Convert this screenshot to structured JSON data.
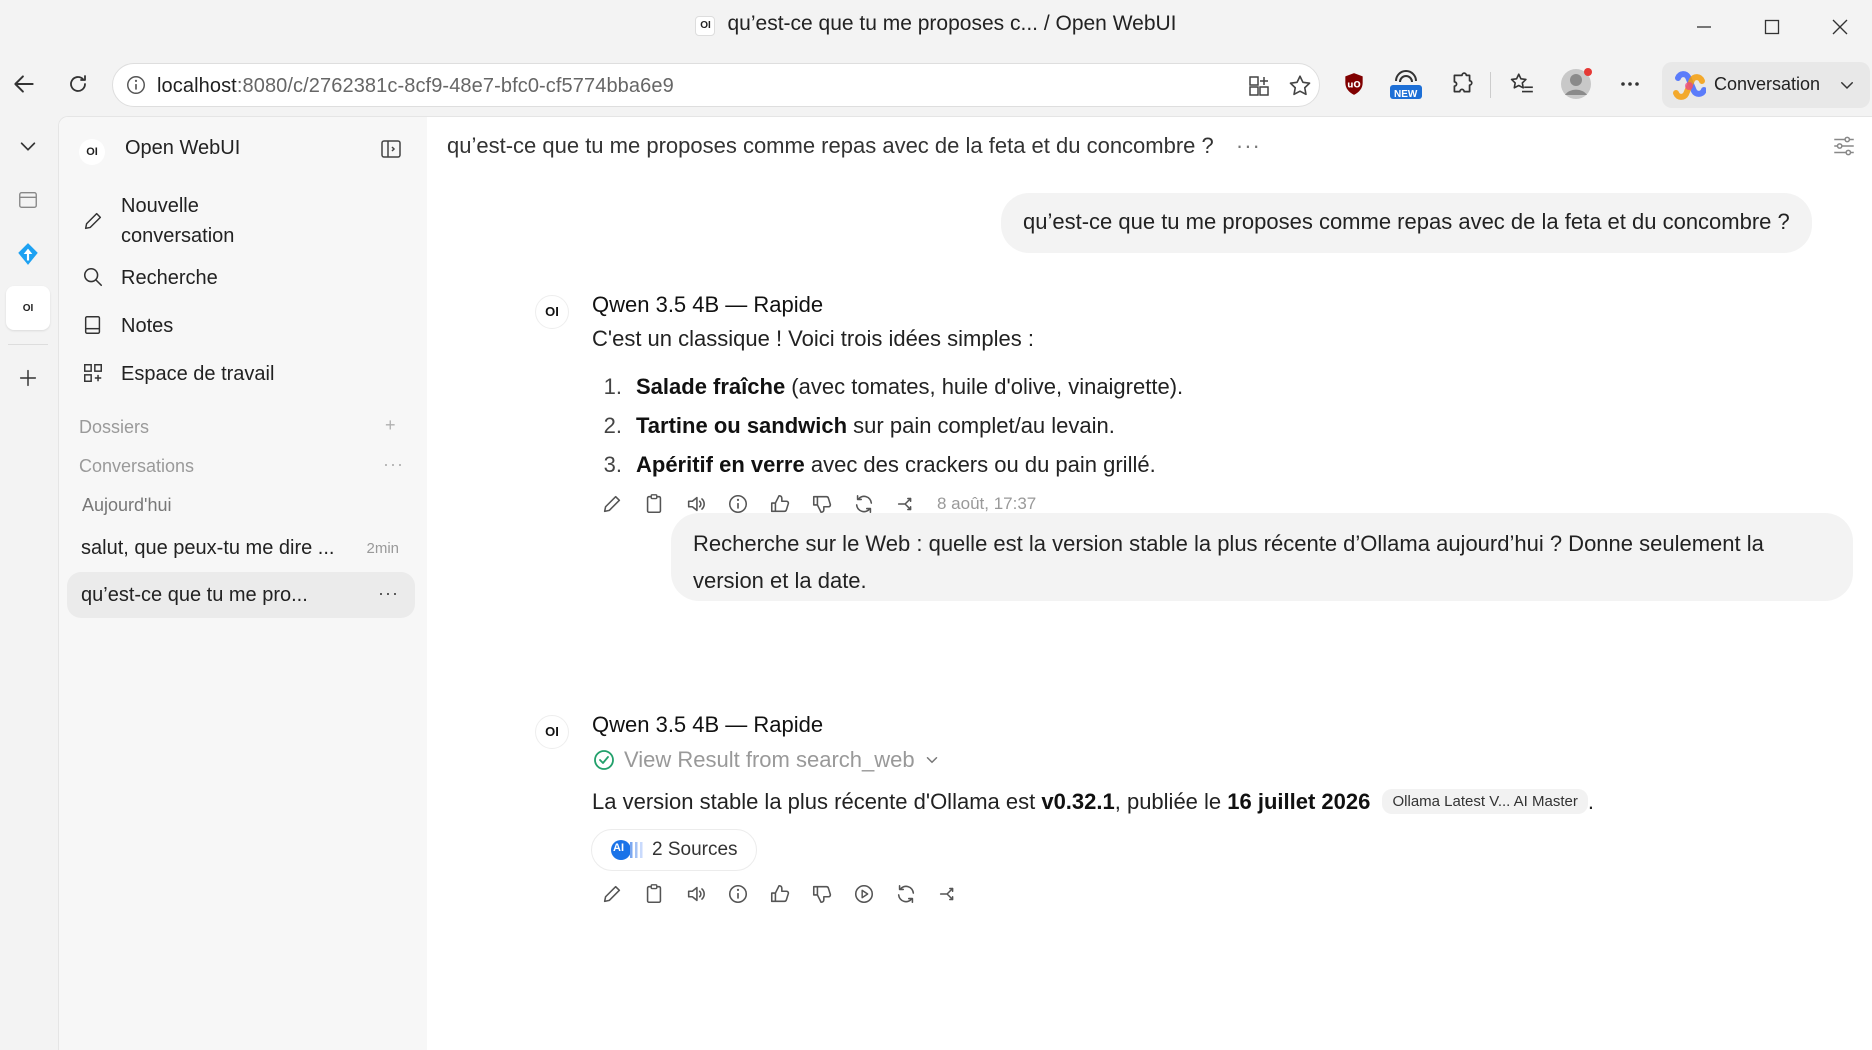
{
  "browser": {
    "window_title": "qu’est-ce que tu me proposes c... / Open WebUI",
    "favicon_text": "OI",
    "url_host": "localhost",
    "url_path": ":8080/c/2762381c-8cf9-48e7-bfc0-cf5774bba6e9",
    "extension_badge": "NEW",
    "copilot_label": "Conversation"
  },
  "tabstrip": {
    "active_tab_text": "OI"
  },
  "sidebar": {
    "logo_text": "OI",
    "brand": "Open WebUI",
    "nav": [
      {
        "label": "Nouvelle conversation",
        "line1": "Nouvelle",
        "line2": "conversation"
      },
      {
        "label": "Recherche"
      },
      {
        "label": "Notes"
      },
      {
        "label": "Espace de travail"
      }
    ],
    "folders_label": "Dossiers",
    "folders_add": "+",
    "conversations_label": "Conversations",
    "conversations_more": "···",
    "today_label": "Aujourd'hui",
    "conversations": [
      {
        "title": "salut, que peux-tu me dire ...",
        "meta": "2min"
      },
      {
        "title": "qu’est-ce que tu me pro...",
        "meta": "···"
      }
    ]
  },
  "chat": {
    "title": "qu’est-ce que tu me proposes comme repas avec de la feta et du concombre ?",
    "title_more": "···",
    "messages": [
      {
        "role": "user",
        "text": "qu’est-ce que tu me proposes comme repas avec de la feta et du concombre ?"
      },
      {
        "role": "assistant",
        "avatar": "OI",
        "model": "Qwen 3.5 4B — Rapide",
        "intro": "C'est un classique ! Voici trois idées simples :",
        "list": [
          {
            "num": "1.",
            "bold": "Salade fraîche",
            "rest": " (avec tomates, huile d'olive, vinaigrette)."
          },
          {
            "num": "2.",
            "bold": "Tartine ou sandwich",
            "rest": " sur pain complet/au levain."
          },
          {
            "num": "3.",
            "bold": "Apéritif en verre",
            "rest": " avec des crackers ou du pain grillé."
          }
        ],
        "timestamp": "8 août, 17:37"
      },
      {
        "role": "user",
        "line1": "Recherche sur le Web : quelle est la version stable la plus récente d’Ollama aujourd’hui ? Donne seulement la",
        "line2": "version et la date."
      },
      {
        "role": "assistant",
        "avatar": "OI",
        "model": "Qwen 3.5 4B — Rapide",
        "tool_result": "View Result from search_web",
        "answer_pre": "La version stable la plus récente d'Ollama est ",
        "answer_version": "v0.32.1",
        "answer_mid": ", publiée le ",
        "answer_date": "16 juillet 2026",
        "citation": "Ollama Latest V... AI Master",
        "answer_end": ".",
        "sources_label": "2 Sources",
        "sources_icon_text": "AI"
      }
    ]
  },
  "colors": {
    "accent_check": "#22a06b",
    "sidebar_bg": "#f7f7f7",
    "bubble_bg": "#f3f3f3",
    "copilot_bg": "#e8e8e8"
  }
}
